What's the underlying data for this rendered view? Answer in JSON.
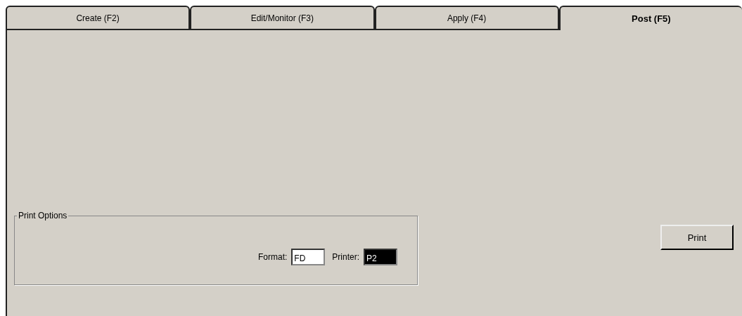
{
  "tabs": [
    {
      "label": "Create (F2)",
      "selected": false
    },
    {
      "label": "Edit/Monitor (F3)",
      "selected": false
    },
    {
      "label": "Apply (F4)",
      "selected": false
    },
    {
      "label": "Post (F5)",
      "selected": true
    }
  ],
  "print_options": {
    "title": "Print Options",
    "fields": [
      {
        "label": "Format:",
        "value": "FD",
        "selected": false
      },
      {
        "label": "Printer:",
        "value": "P2",
        "selected": true
      }
    ]
  },
  "buttons": [
    "Print"
  ]
}
